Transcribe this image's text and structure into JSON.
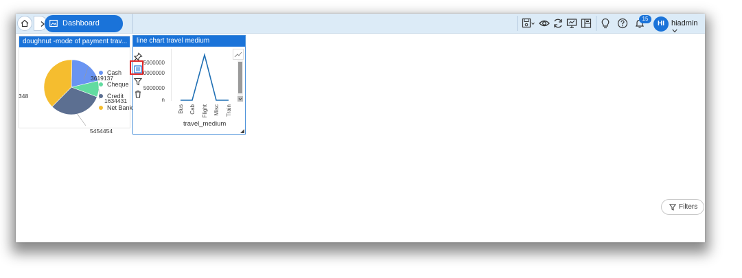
{
  "breadcrumb": {
    "current": "Dashboard Designer"
  },
  "toolbar": {
    "notification_count": "15",
    "avatar_initials": "HI",
    "username": "hiadmin"
  },
  "widget1": {
    "title": "doughnut -mode of payment trav...",
    "chart_data": {
      "type": "pie",
      "categories": [
        "Cash",
        "Cheque",
        "Credit",
        "Net Bank"
      ],
      "values": [
        3619137,
        1634431,
        5454454,
        null
      ],
      "visible_labels": [
        "3619137",
        "1634431",
        "5454454",
        "348"
      ],
      "colors": [
        "#6994f2",
        "#62dba0",
        "#5c6f91",
        "#f5bd2f"
      ],
      "legend_position": "right"
    }
  },
  "widget2": {
    "title": "line chart travel medium",
    "chart_data": {
      "type": "line",
      "categories": [
        "Bus",
        "Cab",
        "Flight",
        "Misc",
        "Train"
      ],
      "xlabel": "travel_medium",
      "ytick_labels": [
        "5000000",
        "0000000",
        "5000000",
        "n"
      ],
      "color": "#1f6fb4"
    }
  },
  "filters": {
    "label": "Filters"
  }
}
